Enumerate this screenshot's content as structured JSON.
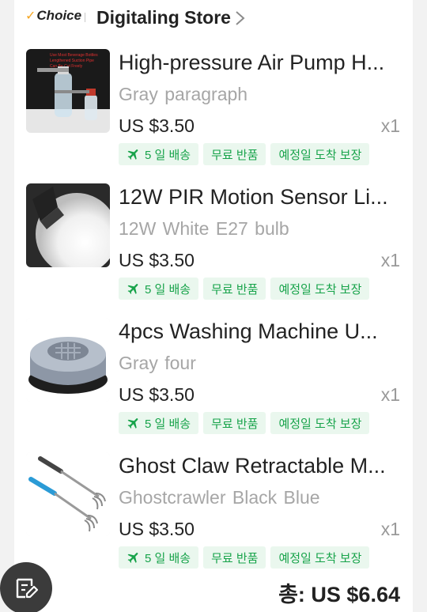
{
  "store": {
    "choice_label": "Choice",
    "name": "Digitaling Store",
    "chevron_icon": "chevron-right-icon"
  },
  "items": [
    {
      "title": "High-pressure Air Pump H...",
      "variant": "Gray paragraph",
      "price": "US $3.50",
      "qty": "x1",
      "tags": [
        "5 일 배송",
        "무료 반품",
        "예정일 도착 보장"
      ],
      "thumb_icon": "air-pump-bottles-image"
    },
    {
      "title": "12W PIR Motion Sensor Li...",
      "variant": "12W White E27 bulb",
      "price": "US $3.50",
      "qty": "x1",
      "tags": [
        "5 일 배송",
        "무료 반품",
        "예정일 도착 보장"
      ],
      "thumb_icon": "led-bulb-image"
    },
    {
      "title": "4pcs Washing Machine U...",
      "variant": "Gray four",
      "price": "US $3.50",
      "qty": "x1",
      "tags": [
        "5 일 배송",
        "무료 반품",
        "예정일 도착 보장"
      ],
      "thumb_icon": "washing-machine-pad-image"
    },
    {
      "title": "Ghost Claw Retractable M...",
      "variant": "Ghostcrawler  Black   Blue",
      "price": "US $3.50",
      "qty": "x1",
      "tags": [
        "5 일 배송",
        "무료 반품",
        "예정일 도착 보장"
      ],
      "thumb_icon": "back-scratcher-image"
    }
  ],
  "total": "총: US $6.64",
  "fab_icon": "edit-note-icon",
  "colors": {
    "tag_bg": "#eaf7ee",
    "tag_text": "#17a34a",
    "choice_check": "#f5a623",
    "fab_bg": "#3b3b3b"
  }
}
